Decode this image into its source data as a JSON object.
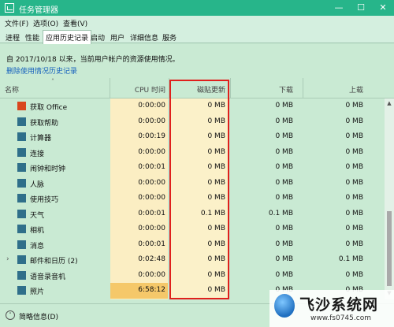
{
  "window": {
    "title": "任务管理器",
    "minimize": "—",
    "maximize": "☐",
    "close": "✕"
  },
  "menu": [
    "文件(F)",
    "选项(O)",
    "查看(V)"
  ],
  "tabs": [
    "进程",
    "性能",
    "应用历史记录",
    "启动",
    "用户",
    "详细信息",
    "服务"
  ],
  "active_tab": "应用历史记录",
  "summary_text": "自 2017/10/18 以来，当前用户帐户的资源使用情况。",
  "reset_link": "删除使用情况历史记录",
  "columns": {
    "name": "名称",
    "cpu": "CPU 时间",
    "net": "磁贴更新",
    "download": "下载",
    "upload": "上载"
  },
  "rows": [
    {
      "name": "获取 Office",
      "cpu": "0:00:00",
      "net": "0 MB",
      "download": "0 MB",
      "upload": "0 MB",
      "icon": "office-icon"
    },
    {
      "name": "获取帮助",
      "cpu": "0:00:00",
      "net": "0 MB",
      "download": "0 MB",
      "upload": "0 MB",
      "icon": "help-icon"
    },
    {
      "name": "计算器",
      "cpu": "0:00:19",
      "net": "0 MB",
      "download": "0 MB",
      "upload": "0 MB",
      "icon": "calculator-icon"
    },
    {
      "name": "连接",
      "cpu": "0:00:00",
      "net": "0 MB",
      "download": "0 MB",
      "upload": "0 MB",
      "icon": "connect-icon"
    },
    {
      "name": "闹钟和时钟",
      "cpu": "0:00:01",
      "net": "0 MB",
      "download": "0 MB",
      "upload": "0 MB",
      "icon": "alarm-icon"
    },
    {
      "name": "人脉",
      "cpu": "0:00:00",
      "net": "0 MB",
      "download": "0 MB",
      "upload": "0 MB",
      "icon": "people-icon"
    },
    {
      "name": "使用技巧",
      "cpu": "0:00:00",
      "net": "0 MB",
      "download": "0 MB",
      "upload": "0 MB",
      "icon": "tips-icon"
    },
    {
      "name": "天气",
      "cpu": "0:00:01",
      "net": "0.1 MB",
      "download": "0.1 MB",
      "upload": "0 MB",
      "icon": "weather-icon"
    },
    {
      "name": "相机",
      "cpu": "0:00:00",
      "net": "0 MB",
      "download": "0 MB",
      "upload": "0 MB",
      "icon": "camera-icon"
    },
    {
      "name": "消息",
      "cpu": "0:00:01",
      "net": "0 MB",
      "download": "0 MB",
      "upload": "0 MB",
      "icon": "message-icon"
    },
    {
      "name": "邮件和日历 (2)",
      "cpu": "0:02:48",
      "net": "0 MB",
      "download": "0 MB",
      "upload": "0.1 MB",
      "icon": "mail-icon",
      "expandable": true
    },
    {
      "name": "语音录音机",
      "cpu": "0:00:00",
      "net": "0 MB",
      "download": "0 MB",
      "upload": "0 MB",
      "icon": "recorder-icon"
    },
    {
      "name": "照片",
      "cpu": "6:58:12",
      "net": "0 MB",
      "download": "0 MB",
      "upload": "0 MB",
      "icon": "photos-icon",
      "hot": true
    }
  ],
  "footer": {
    "toggle": "˄",
    "label": "简略信息(D)"
  },
  "watermark": {
    "title": "飞沙系统网",
    "url": "www.fs0745.com"
  },
  "colors": {
    "titlebar": "#27b58a",
    "highlight_box": "#e0201c",
    "cpu_hot": "#f5c86a"
  }
}
